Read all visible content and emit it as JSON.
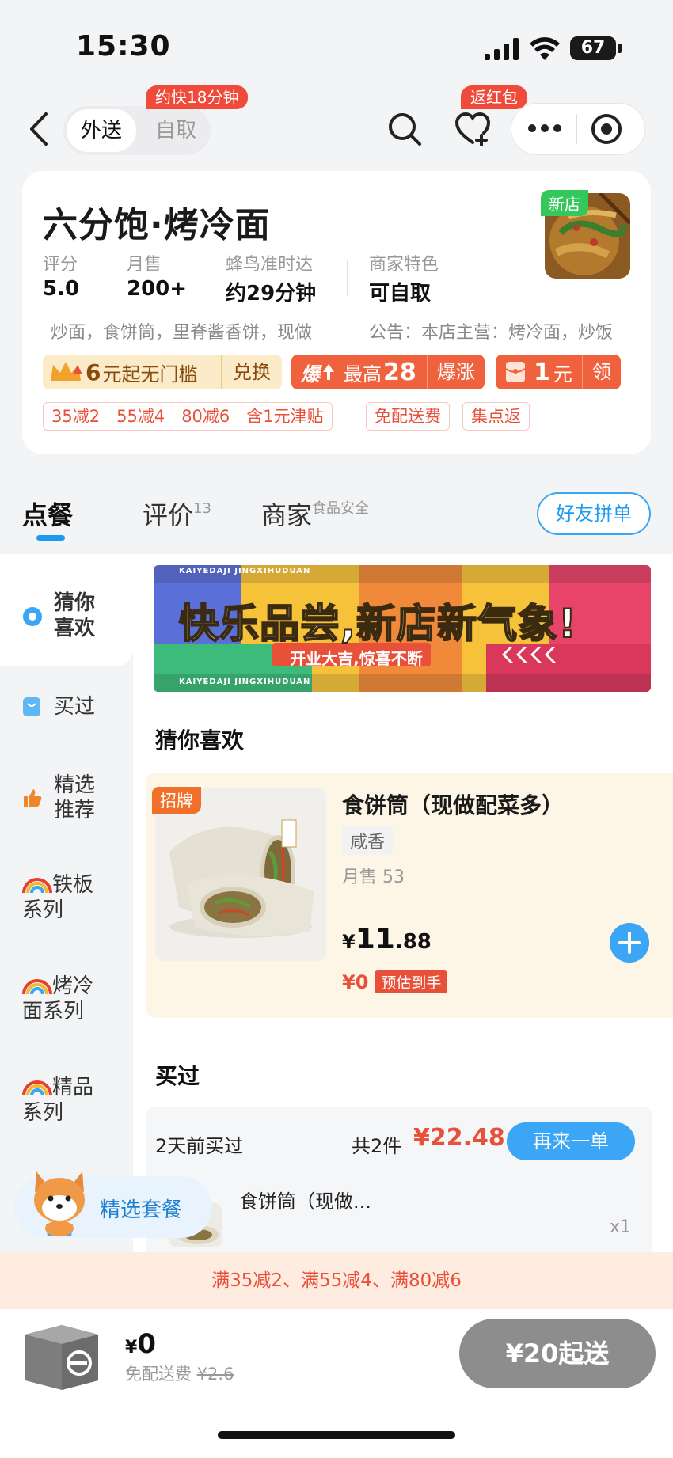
{
  "status_bar": {
    "time": "15:30",
    "battery": "67"
  },
  "header": {
    "mode_delivery": "外送",
    "mode_pickup": "自取",
    "faster_tag": "约快18分钟",
    "redpacket_tag": "返红包"
  },
  "store": {
    "name": "六分饱·烤冷面",
    "new_badge": "新店",
    "stats": [
      {
        "label": "评分",
        "value": "5.0"
      },
      {
        "label": "月售",
        "value": "200+"
      },
      {
        "label": "蜂鸟准时达",
        "value": "约29分钟"
      },
      {
        "label": "商家特色",
        "value": "可自取"
      }
    ],
    "desc_left": "炒面，食饼筒，里脊酱香饼，现做",
    "desc_right": "公告：本店主营：烤冷面，炒饭",
    "promo1": {
      "amount": "6",
      "text": "元起无门槛",
      "action": "兑换"
    },
    "promo2": {
      "icon_text": "爆",
      "label": "最高",
      "amount": "28",
      "action": "爆涨"
    },
    "promo3": {
      "amount": "1",
      "unit": "元",
      "action": "领"
    },
    "chips": [
      "35减2",
      "55减4",
      "80减6",
      "含1元津贴"
    ],
    "chip_free": "免配送费",
    "chip_points": "集点返"
  },
  "tabs": {
    "order": "点餐",
    "reviews": "评价",
    "reviews_count": "13",
    "merchant": "商家",
    "merchant_sup": "食品安全",
    "group_button": "好友拼单"
  },
  "sidebar": {
    "items": [
      {
        "label": "猜你\n喜欢"
      },
      {
        "label": "买过"
      },
      {
        "label": "精选\n推荐"
      },
      {
        "label": "铁板\n系列"
      },
      {
        "label": "烤冷\n面系列"
      },
      {
        "label": "精品\n系列"
      }
    ]
  },
  "banner": {
    "ribbon_text": "KAIYEDAJI JINGXIHUDUAN",
    "headline": "快乐品尝,新店新气象!",
    "subline": "开业大吉,惊喜不断"
  },
  "guess_section": {
    "title": "猜你喜欢",
    "product": {
      "badge": "招牌",
      "name": "食饼筒（现做配菜多）",
      "flavor": "咸香",
      "sales": "月售 53",
      "price_currency": "¥",
      "price_int": "11",
      "price_dec": ".88",
      "est_price": "¥0",
      "est_label": "预估到手"
    }
  },
  "bought_section": {
    "title": "买过",
    "when": "2天前买过",
    "count": "共2件",
    "total": "¥22.48",
    "reorder": "再来一单",
    "item_name": "食饼筒（现做...",
    "qty": "x1"
  },
  "combo": {
    "label": "精选套餐"
  },
  "discount_bar": "满35减2、满55减4、满80减6",
  "cart": {
    "currency": "¥",
    "amount": "0",
    "fee_label": "免配送费",
    "fee_original": "¥2.6",
    "checkout": "¥20起送"
  },
  "colors": {
    "accent_blue": "#3aa6f5",
    "accent_red": "#f04a3a",
    "orange": "#f0702a"
  }
}
